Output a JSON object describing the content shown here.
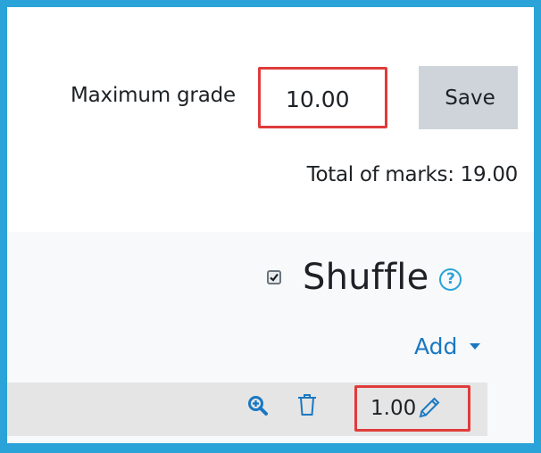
{
  "grading": {
    "max_grade_label": "Maximum grade",
    "max_grade_value": "10.00",
    "save_label": "Save",
    "total_marks": "Total of marks: 19.00"
  },
  "section": {
    "shuffle_label": "Shuffle",
    "shuffle_checked": true,
    "help_glyph": "?",
    "add_label": "Add"
  },
  "question": {
    "mark": "1.00"
  },
  "icons": {
    "help": "help-icon",
    "preview": "magnifier-plus-icon",
    "delete": "trash-icon",
    "edit": "pencil-icon",
    "add_caret": "caret-down-icon"
  },
  "colors": {
    "frame": "#2aa3d8",
    "highlight": "#e03b3b",
    "link": "#1a78c2",
    "save_button_bg": "#ced4da"
  }
}
